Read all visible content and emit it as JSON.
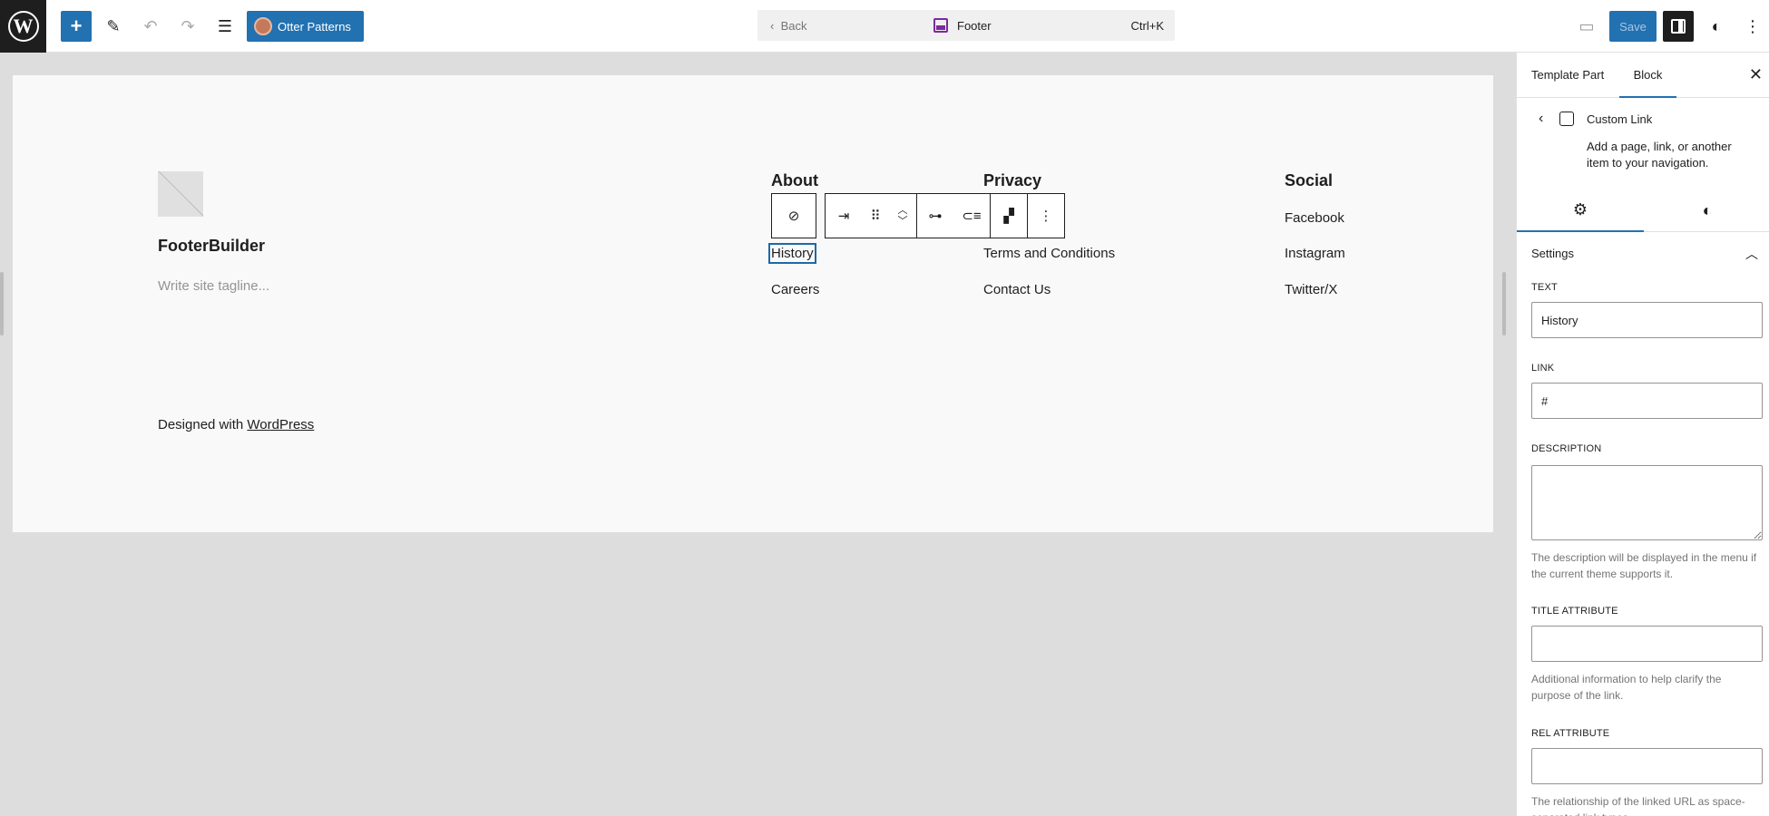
{
  "topbar": {
    "otter_label": "Otter Patterns",
    "command": {
      "back": "Back",
      "title": "Footer",
      "shortcut": "Ctrl+K"
    },
    "save_label": "Save"
  },
  "canvas": {
    "site_title": "FooterBuilder",
    "tagline_placeholder": "Write site tagline...",
    "credit_prefix": "Designed with ",
    "credit_link": "WordPress",
    "columns": [
      {
        "heading": "About",
        "links": [
          "History",
          "Careers"
        ]
      },
      {
        "heading": "Privacy",
        "links": [
          "Terms and Conditions",
          "Contact Us"
        ]
      },
      {
        "heading": "Social",
        "links": [
          "Facebook",
          "Instagram",
          "Twitter/X"
        ]
      }
    ]
  },
  "sidebar": {
    "tabs": [
      "Template Part",
      "Block"
    ],
    "block": {
      "title": "Custom Link",
      "description": "Add a page, link, or another item to your navigation."
    },
    "panel_title": "Settings",
    "fields": {
      "text_label": "TEXT",
      "text_value": "History",
      "link_label": "LINK",
      "link_value": "#",
      "description_label": "DESCRIPTION",
      "description_help": "The description will be displayed in the menu if the current theme supports it.",
      "title_label": "TITLE ATTRIBUTE",
      "title_help": "Additional information to help clarify the purpose of the link.",
      "rel_label": "REL ATTRIBUTE",
      "rel_help": "The relationship of the linked URL as space-separated link types."
    }
  },
  "colors": {
    "accent": "#2271b1",
    "template_part": "#7a2b9e"
  }
}
